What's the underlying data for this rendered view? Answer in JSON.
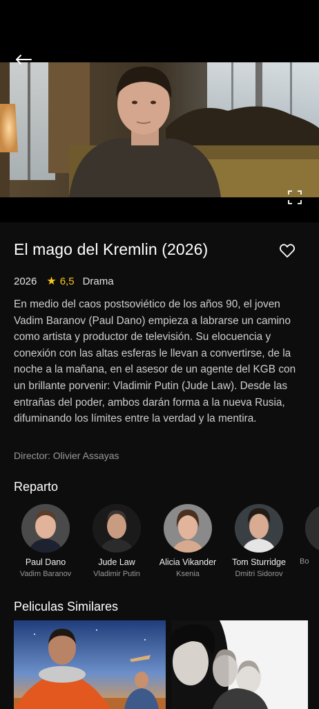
{
  "movie": {
    "title": "El mago del Kremlin (2026)",
    "year": "2026",
    "rating": "6,5",
    "genre": "Drama",
    "synopsis": "En medio del caos postsoviético de los años 90, el joven Vadim Baranov (Paul Dano) empieza a labrarse un camino como artista y productor de televisión. Su elocuencia y conexión con las altas esferas le llevan a convertirse, de la noche a la mañana, en el asesor de un agente del KGB con un brillante porvenir: Vladimir Putin (Jude Law). Desde las entrañas del poder, ambos darán forma a la nueva Rusia, difuminando los límites entre la verdad y la mentira.",
    "director": "Director: Olivier Assayas"
  },
  "icons": {
    "back": "arrow-left-icon",
    "fullscreen": "fullscreen-icon",
    "favorite": "heart-outline-icon",
    "star": "star-icon"
  },
  "colors": {
    "background": "#0d0d0d",
    "rating_star": "#f5c518",
    "text_secondary": "#9a9a9a"
  },
  "cast_section": {
    "title": "Reparto",
    "members": [
      {
        "name": "Paul Dano",
        "role": "Vadim Baranov"
      },
      {
        "name": "Jude Law",
        "role": "Vladimir Putin"
      },
      {
        "name": "Alicia Vikander",
        "role": "Ksenia"
      },
      {
        "name": "Tom Sturridge",
        "role": "Dmitri Sidorov"
      },
      {
        "name": "",
        "role": "Bo"
      }
    ]
  },
  "similar_section": {
    "title": "Peliculas Similares"
  }
}
